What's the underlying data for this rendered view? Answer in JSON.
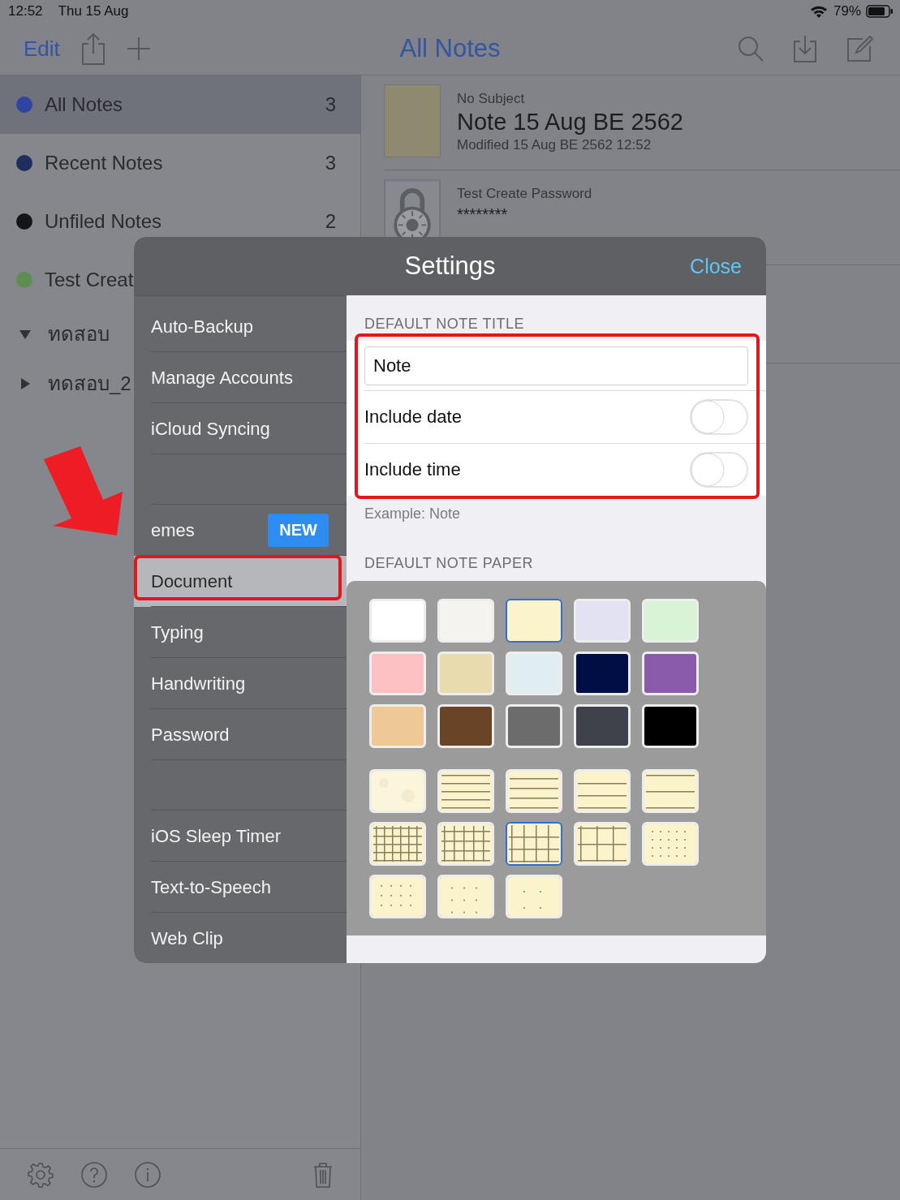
{
  "status_bar": {
    "time": "12:52",
    "date": "Thu 15 Aug",
    "battery": "79%"
  },
  "nav_bar": {
    "edit": "Edit",
    "title": "All Notes"
  },
  "sidebar": {
    "items": [
      {
        "kind": "collection",
        "label": "All Notes",
        "count": "3",
        "color": "#2f44a0",
        "selected": true
      },
      {
        "kind": "collection",
        "label": "Recent Notes",
        "count": "3",
        "color": "#1f2e5e",
        "selected": false
      },
      {
        "kind": "collection",
        "label": "Unfiled Notes",
        "count": "2",
        "color": "#131519",
        "selected": false
      },
      {
        "kind": "collection",
        "label": "Test Creat",
        "color": "#5d8d4f",
        "selected": false
      },
      {
        "kind": "folder",
        "label": "ทดสอบ",
        "expanded": true,
        "selected": false
      },
      {
        "kind": "folder",
        "label": "ทดสอบ_2",
        "expanded": false,
        "selected": false
      }
    ]
  },
  "notes": [
    {
      "subject": "No Subject",
      "title": "Note 15 Aug BE 2562",
      "modified": "Modified 15 Aug BE 2562 12:52",
      "kind": "paper"
    },
    {
      "subject": "Test Create Password",
      "title": "********",
      "kind": "locked"
    }
  ],
  "settings": {
    "title": "Settings",
    "close": "Close",
    "menu_sections": [
      [
        {
          "label": "Auto-Backup",
          "selected": false
        },
        {
          "label": "Manage Accounts",
          "selected": false
        },
        {
          "label": "iCloud Syncing",
          "selected": false
        }
      ],
      [
        {
          "label": "emes",
          "badge": "NEW",
          "selected": false
        },
        {
          "label": "Document",
          "selected": true
        },
        {
          "label": "Typing",
          "selected": false
        },
        {
          "label": "Handwriting",
          "selected": false
        },
        {
          "label": "Password",
          "selected": false
        }
      ],
      [
        {
          "label": "iOS Sleep Timer",
          "selected": false
        },
        {
          "label": "Text-to-Speech",
          "selected": false
        },
        {
          "label": "Web Clip",
          "selected": false
        }
      ]
    ],
    "title_section": {
      "header": "DEFAULT NOTE TITLE",
      "value": "Note",
      "toggles": [
        {
          "label": "Include date",
          "on": false
        },
        {
          "label": "Include time",
          "on": false
        }
      ],
      "example": "Example: Note"
    },
    "paper_section": {
      "header": "DEFAULT NOTE PAPER",
      "colors": [
        {
          "color": "#ffffff",
          "selected": false
        },
        {
          "color": "#f5f3ef",
          "selected": false
        },
        {
          "color": "#fbf3c9",
          "selected": true
        },
        {
          "color": "#e2e2f3",
          "selected": false
        },
        {
          "color": "#d9f3d6",
          "selected": false
        },
        {
          "color": "#fdc0c3",
          "selected": false
        },
        {
          "color": "#e8dcae",
          "selected": false
        },
        {
          "color": "#e0eef2",
          "selected": false
        },
        {
          "color": "#000e46",
          "selected": false
        },
        {
          "color": "#8a5ba8",
          "selected": false
        },
        {
          "color": "#eec996",
          "selected": false
        },
        {
          "color": "#6a4427",
          "selected": false
        },
        {
          "color": "#6c6c6c",
          "selected": false
        },
        {
          "color": "#3f414b",
          "selected": false
        },
        {
          "color": "#000000",
          "selected": false
        }
      ],
      "patterns": [
        {
          "kind": "texture",
          "selected": false
        },
        {
          "kind": "lines-dense",
          "selected": false
        },
        {
          "kind": "lines-fine",
          "selected": false
        },
        {
          "kind": "lines-medium",
          "selected": false
        },
        {
          "kind": "lines-wide",
          "selected": false
        },
        {
          "kind": "grid-dense",
          "selected": false
        },
        {
          "kind": "grid-fine",
          "selected": false
        },
        {
          "kind": "grid-medium",
          "selected": true
        },
        {
          "kind": "grid-wide",
          "selected": false
        },
        {
          "kind": "dots-dense",
          "selected": false
        },
        {
          "kind": "dots-fine",
          "selected": false
        },
        {
          "kind": "dots-medium",
          "selected": false
        },
        {
          "kind": "dots-wide",
          "selected": false
        }
      ]
    }
  },
  "annotations": [
    {
      "kind": "arrow"
    },
    {
      "kind": "menu-frame"
    },
    {
      "kind": "title-frame"
    }
  ]
}
